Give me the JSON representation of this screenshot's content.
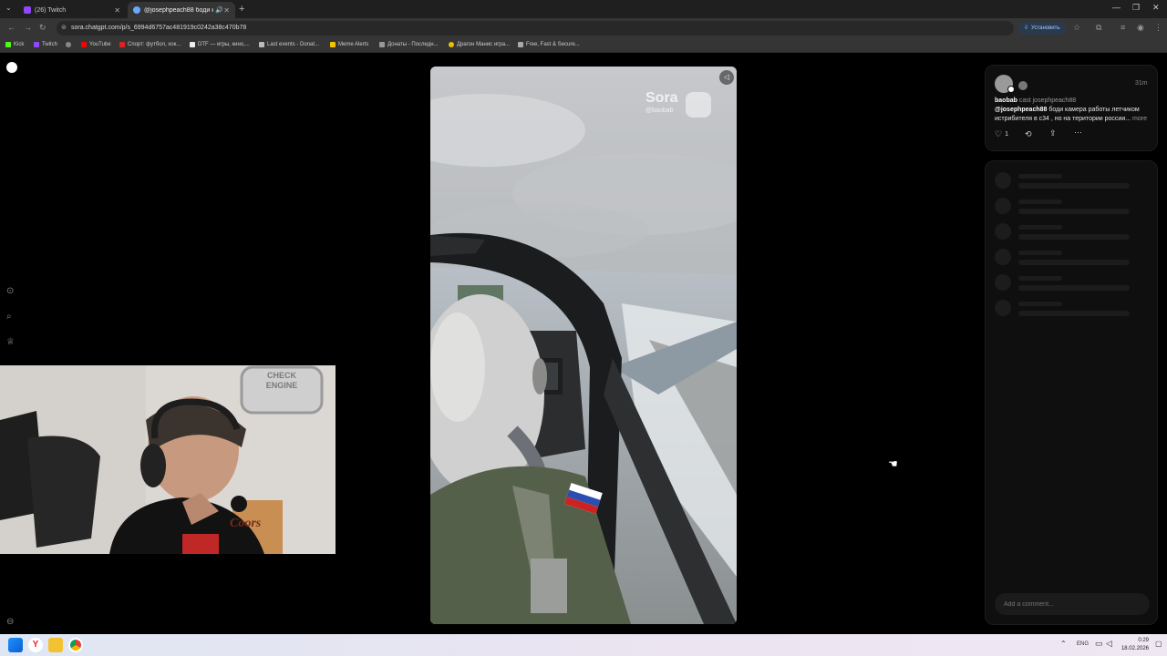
{
  "browser": {
    "tabs": [
      {
        "label": "(26) Twitch",
        "active": false
      },
      {
        "label": "@josephpeach88 боди ка...",
        "active": true
      }
    ],
    "url": "sora.chatgpt.com/p/s_6994d6757ac481919c0242a38c470b78",
    "install_label": "Установить",
    "bookmarks": [
      {
        "label": "Kick",
        "color": "#53fc18"
      },
      {
        "label": "Twitch",
        "color": "#9146ff"
      },
      {
        "label": "",
        "color": "#888888"
      },
      {
        "label": "YouTube",
        "color": "#ff0000"
      },
      {
        "label": "Спорт: футбол, хок...",
        "color": "#d22"
      },
      {
        "label": "DTF — игры, кино,...",
        "color": "#ddd"
      },
      {
        "label": "Last events - Donat...",
        "color": "#bbb"
      },
      {
        "label": "Meme Alerts",
        "color": "#f5c400"
      },
      {
        "label": "Донаты - Последн...",
        "color": "#999"
      },
      {
        "label": "Драгон Манис игра...",
        "color": "#e8c200"
      },
      {
        "label": "Free, Fast & Secure...",
        "color": "#aaa"
      }
    ]
  },
  "video": {
    "watermark": "Sora",
    "watermark_handle": "@baobab"
  },
  "post": {
    "author": "baobab",
    "cast_text": "cast josephpeach88",
    "time": "31m",
    "mention": "@josephpeach88",
    "caption": "боди камера работы летчиком истрибителя в с34 , но на територии россии...",
    "more_label": "more",
    "likes": "1"
  },
  "comments": {
    "placeholder": "Add a comment..."
  },
  "webcam": {
    "sign_text_1": "CHECK",
    "sign_text_2": "ENGINE",
    "shirt_text": "Coors"
  },
  "taskbar": {
    "lang": "ENG",
    "time": "0:29",
    "date": "18.02.2026"
  }
}
